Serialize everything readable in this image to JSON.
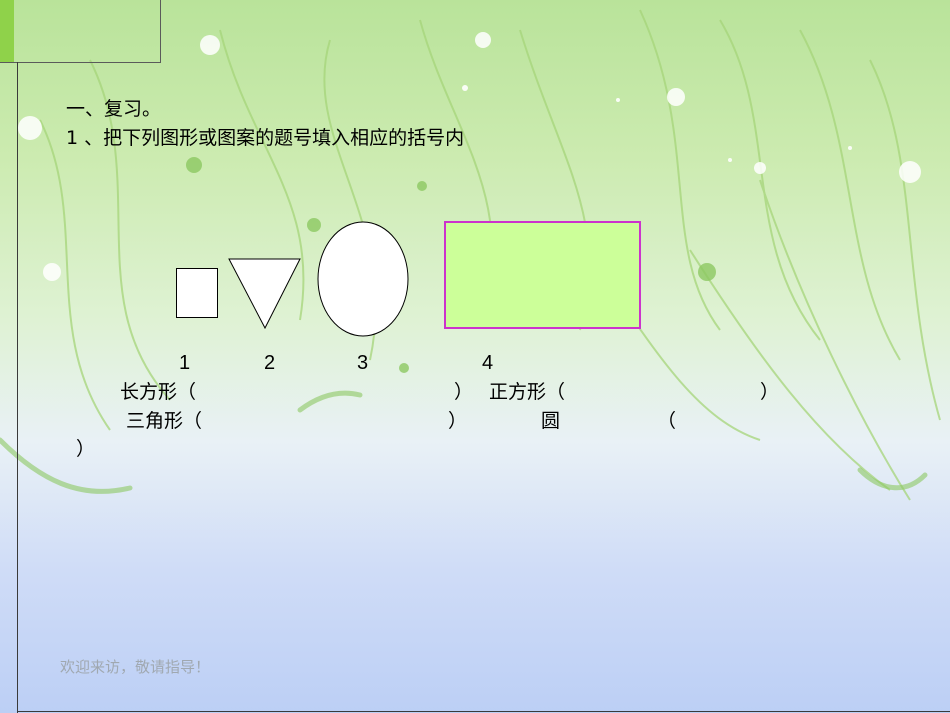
{
  "slide": {
    "heading": "一、复习。",
    "question": "1 、把下列图形或图案的题号填入相应的括号内",
    "shape_numbers": [
      "1",
      "2",
      "3",
      "4"
    ],
    "answer_lines": {
      "rectangle_label": "长方形（",
      "rectangle_close": "）",
      "square_label": "正方形（",
      "square_close": "）",
      "triangle_label": "三角形（",
      "triangle_close": "）",
      "circle_label": "圆",
      "circle_open": "（",
      "circle_close": "）"
    },
    "footer": "欢迎来访，敬请指导！"
  },
  "colors": {
    "rect_fill": "#ccff99",
    "rect_border": "#cc33cc",
    "background_top": "#b9e39a",
    "background_bottom": "#bccff5"
  }
}
